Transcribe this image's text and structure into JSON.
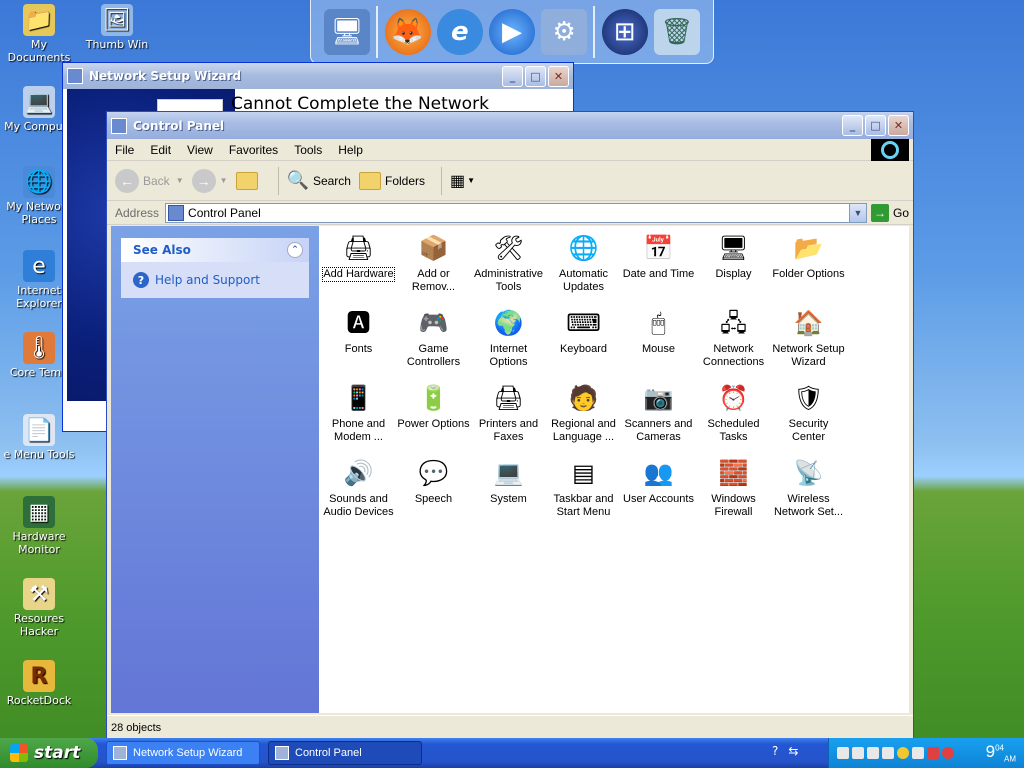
{
  "desktop": {
    "icons": [
      {
        "label": "My Documents"
      },
      {
        "label": "Thumb Win"
      },
      {
        "label": "My Compute"
      },
      {
        "label": "My Network Places"
      },
      {
        "label": "Internet Explorer"
      },
      {
        "label": "Core Temp"
      },
      {
        "label": "e Menu Tools"
      },
      {
        "label": "Hardware Monitor"
      },
      {
        "label": "Resoures Hacker"
      },
      {
        "label": "RocketDock"
      }
    ]
  },
  "wizard": {
    "title": "Network Setup Wizard",
    "heading": "Cannot Complete the Network Setup Wizard"
  },
  "control_panel": {
    "title": "Control Panel",
    "menu": [
      "File",
      "Edit",
      "View",
      "Favorites",
      "Tools",
      "Help"
    ],
    "toolbar": {
      "back": "Back",
      "search": "Search",
      "folders": "Folders"
    },
    "address": {
      "label": "Address",
      "value": "Control Panel",
      "go": "Go"
    },
    "see_also": {
      "title": "See Also",
      "help": "Help and Support"
    },
    "items": [
      {
        "label": "Add Hardware",
        "icon": "hardware-icon"
      },
      {
        "label": "Add or Remov...",
        "icon": "add-remove-icon"
      },
      {
        "label": "Administrative Tools",
        "icon": "admin-tools-icon"
      },
      {
        "label": "Automatic Updates",
        "icon": "updates-icon"
      },
      {
        "label": "Date and Time",
        "icon": "calendar-icon"
      },
      {
        "label": "Display",
        "icon": "display-icon"
      },
      {
        "label": "Folder Options",
        "icon": "folder-options-icon"
      },
      {
        "label": "Fonts",
        "icon": "fonts-icon"
      },
      {
        "label": "Game Controllers",
        "icon": "gamepad-icon"
      },
      {
        "label": "Internet Options",
        "icon": "internet-options-icon"
      },
      {
        "label": "Keyboard",
        "icon": "keyboard-icon"
      },
      {
        "label": "Mouse",
        "icon": "mouse-icon"
      },
      {
        "label": "Network Connections",
        "icon": "network-connections-icon"
      },
      {
        "label": "Network Setup Wizard",
        "icon": "network-wizard-icon"
      },
      {
        "label": "Phone and Modem ...",
        "icon": "phone-icon"
      },
      {
        "label": "Power Options",
        "icon": "power-icon"
      },
      {
        "label": "Printers and Faxes",
        "icon": "printer-icon"
      },
      {
        "label": "Regional and Language ...",
        "icon": "regional-icon"
      },
      {
        "label": "Scanners and Cameras",
        "icon": "scanner-icon"
      },
      {
        "label": "Scheduled Tasks",
        "icon": "scheduled-tasks-icon"
      },
      {
        "label": "Security Center",
        "icon": "shield-icon"
      },
      {
        "label": "Sounds and Audio Devices",
        "icon": "speaker-icon"
      },
      {
        "label": "Speech",
        "icon": "speech-icon"
      },
      {
        "label": "System",
        "icon": "system-icon"
      },
      {
        "label": "Taskbar and Start Menu",
        "icon": "taskbar-icon"
      },
      {
        "label": "User Accounts",
        "icon": "users-icon"
      },
      {
        "label": "Windows Firewall",
        "icon": "firewall-icon"
      },
      {
        "label": "Wireless Network Set...",
        "icon": "wireless-icon"
      }
    ],
    "status": "28 objects"
  },
  "taskbar": {
    "start": "start",
    "tasks": [
      "Network Setup Wizard",
      "Control Panel"
    ],
    "clock": "9",
    "clock_min": "04",
    "clock_ampm": "AM"
  }
}
